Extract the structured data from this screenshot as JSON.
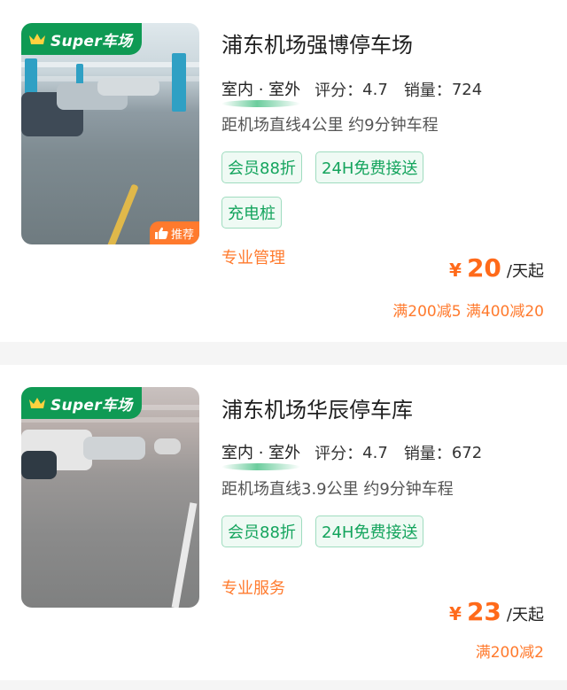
{
  "listings": [
    {
      "title": "浦东机场强博停车场",
      "badge": "Super车场",
      "recommend": "推荐",
      "type": "室内 · 室外",
      "rating_label": "评分：",
      "rating": "4.7",
      "sales_label": "销量：",
      "sales": "724",
      "distance": "距机场直线4公里 约9分钟车程",
      "tags": [
        "会员88折",
        "24H免费接送",
        "充电桩"
      ],
      "feature": "专业管理",
      "currency": "¥",
      "price": "20",
      "price_unit": "/天起",
      "discounts": "满200减5 满400减20"
    },
    {
      "title": "浦东机场华辰停车库",
      "badge": "Super车场",
      "type": "室内 · 室外",
      "rating_label": "评分：",
      "rating": "4.7",
      "sales_label": "销量：",
      "sales": "672",
      "distance": "距机场直线3.9公里 约9分钟车程",
      "tags": [
        "会员88折",
        "24H免费接送"
      ],
      "feature": "专业服务",
      "currency": "¥",
      "price": "23",
      "price_unit": "/天起",
      "discounts": "满200减2"
    }
  ],
  "icons": {
    "badge_icon": "crown-icon",
    "recommend_icon": "thumbs-up-icon"
  },
  "colors": {
    "brand_green": "#0f9a54",
    "tag_green": "#14a45d",
    "accent_orange": "#ff7a2d",
    "price_orange": "#ff6a1a"
  }
}
